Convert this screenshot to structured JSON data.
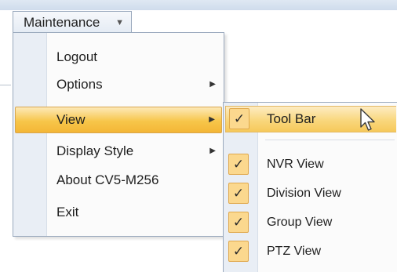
{
  "menubar": {
    "title": "Maintenance",
    "chevron": "▼"
  },
  "menu": {
    "items": [
      {
        "label": "Logout",
        "has_submenu": false,
        "active": false
      },
      {
        "label": "Options",
        "has_submenu": true,
        "active": false
      },
      {
        "label": "View",
        "has_submenu": true,
        "active": true
      },
      {
        "label": "Display Style",
        "has_submenu": true,
        "active": false
      },
      {
        "label": "About CV5-M256",
        "has_submenu": false,
        "active": false
      },
      {
        "label": "Exit",
        "has_submenu": false,
        "active": false
      }
    ],
    "submenu_arrow": "▶"
  },
  "submenu": {
    "items": [
      {
        "label": "Tool Bar",
        "checked": true,
        "hovered": true
      },
      {
        "label": "NVR View",
        "checked": true,
        "hovered": false
      },
      {
        "label": "Division View",
        "checked": true,
        "hovered": false
      },
      {
        "label": "Group View",
        "checked": true,
        "hovered": false
      },
      {
        "label": "PTZ View",
        "checked": true,
        "hovered": false
      }
    ],
    "check_glyph": "✓"
  },
  "colors": {
    "highlight": "#f7c64a",
    "check_bg": "#fbd88e",
    "gutter": "#e9eef5",
    "border": "#9aa9bd"
  },
  "icons": {
    "cursor": "mouse-pointer-icon"
  }
}
